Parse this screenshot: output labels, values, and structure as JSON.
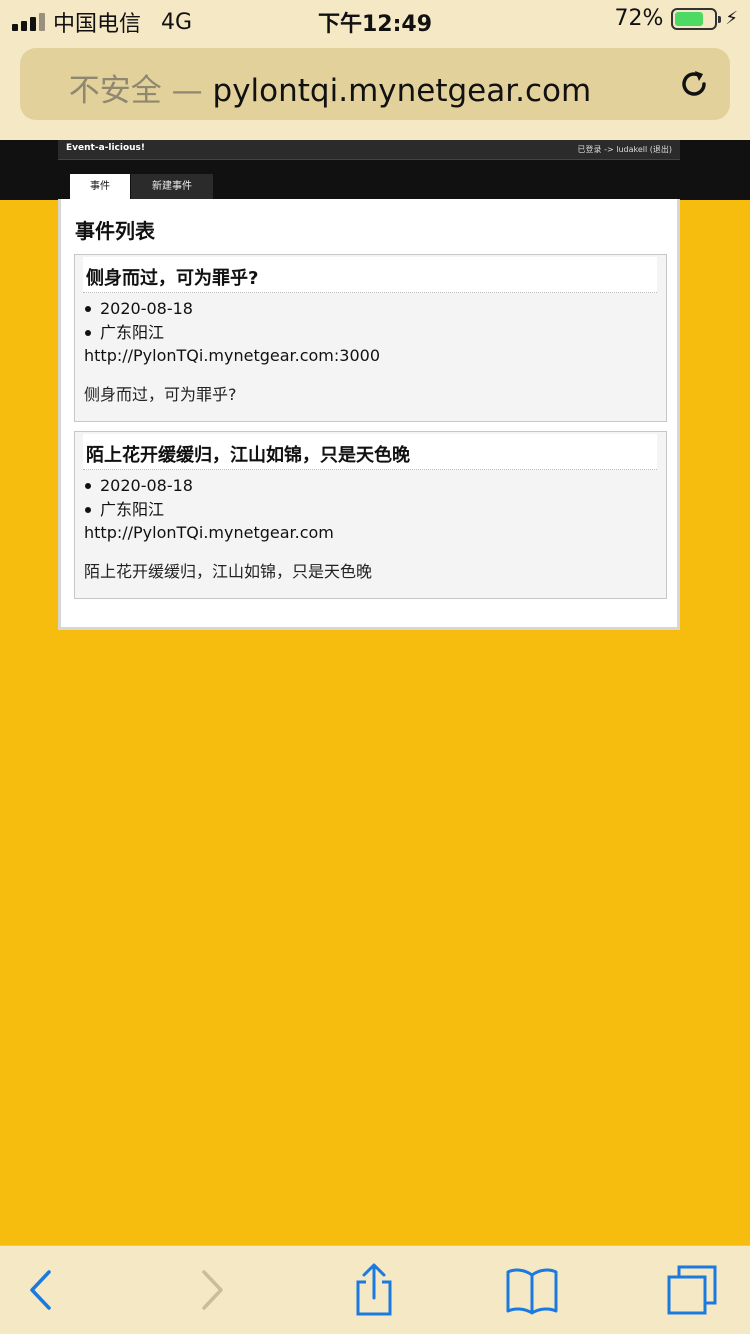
{
  "status_bar": {
    "carrier": "中国电信",
    "network": "4G",
    "time": "下午12:49",
    "battery_percent": "72%",
    "battery_level": 0.72
  },
  "url_bar": {
    "insecure_label": "不安全 —",
    "host": "pylontqi.mynetgear.com"
  },
  "site": {
    "title": "Event-a-licious!",
    "login_info": "已登录 -> ludakell (退出)",
    "tabs": [
      {
        "label": "事件"
      },
      {
        "label": "新建事件"
      }
    ],
    "page_title": "事件列表"
  },
  "events": [
    {
      "title": "侧身而过，可为罪乎?",
      "date": "2020-08-18",
      "location": "广东阳江",
      "url": "http://PylonTQi.mynetgear.com:3000",
      "description": "侧身而过，可为罪乎?"
    },
    {
      "title": "陌上花开缓缓归，江山如锦，只是天色晚",
      "date": "2020-08-18",
      "location": "广东阳江",
      "url": "http://PylonTQi.mynetgear.com",
      "description": "陌上花开缓缓归，江山如锦，只是天色晚"
    }
  ],
  "colors": {
    "page_background": "#f7bd0e",
    "safari_chrome": "#f5e8c4",
    "toolbar_icon_active": "#1a7ae0",
    "toolbar_icon_disabled": "#c9bd9a"
  },
  "toolbar": {
    "icons": [
      "back-icon",
      "forward-icon",
      "share-icon",
      "bookmarks-icon",
      "tabs-icon"
    ]
  }
}
